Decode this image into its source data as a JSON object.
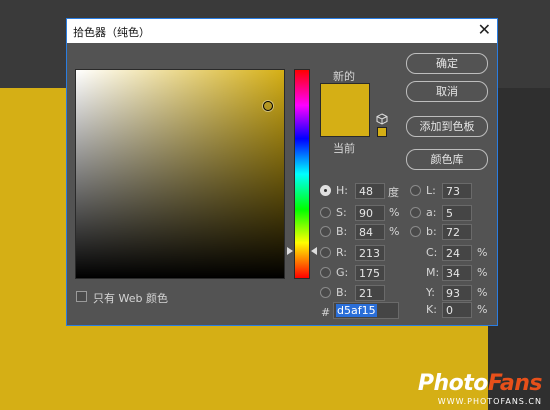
{
  "dialog": {
    "title": "拾色器（纯色）",
    "close_glyph": "✕"
  },
  "preview": {
    "new_label": "新的",
    "current_label": "当前",
    "color": "#d5af15"
  },
  "buttons": {
    "ok": "确定",
    "cancel": "取消",
    "add_to_swatches": "添加到色板",
    "color_libraries": "颜色库"
  },
  "fields": {
    "H": {
      "label": "H:",
      "value": "48",
      "unit": "度",
      "selected": true
    },
    "S": {
      "label": "S:",
      "value": "90",
      "unit": "%"
    },
    "Bv": {
      "label": "B:",
      "value": "84",
      "unit": "%"
    },
    "R": {
      "label": "R:",
      "value": "213"
    },
    "G": {
      "label": "G:",
      "value": "175"
    },
    "B": {
      "label": "B:",
      "value": "21"
    },
    "L": {
      "label": "L:",
      "value": "73"
    },
    "a": {
      "label": "a:",
      "value": "5"
    },
    "b": {
      "label": "b:",
      "value": "72"
    },
    "C": {
      "label": "C:",
      "value": "24",
      "unit": "%"
    },
    "M": {
      "label": "M:",
      "value": "34",
      "unit": "%"
    },
    "Y": {
      "label": "Y:",
      "value": "93",
      "unit": "%"
    },
    "K": {
      "label": "K:",
      "value": "0",
      "unit": "%"
    }
  },
  "hex": {
    "label": "#",
    "value": "d5af15"
  },
  "web_only": {
    "label": "只有 Web 颜色",
    "checked": false
  },
  "watermark": {
    "logo_white": "Photo",
    "logo_orange": "Fans",
    "url": "WWW.PHOTOFANS.CN"
  },
  "colors": {
    "accent": "#2a7de1",
    "gold": "#d5af15",
    "dialog_bg": "#535353",
    "watermark_orange": "#e8501a"
  },
  "icons": {
    "out_of_gamut": "cube-icon",
    "close": "close-icon"
  }
}
